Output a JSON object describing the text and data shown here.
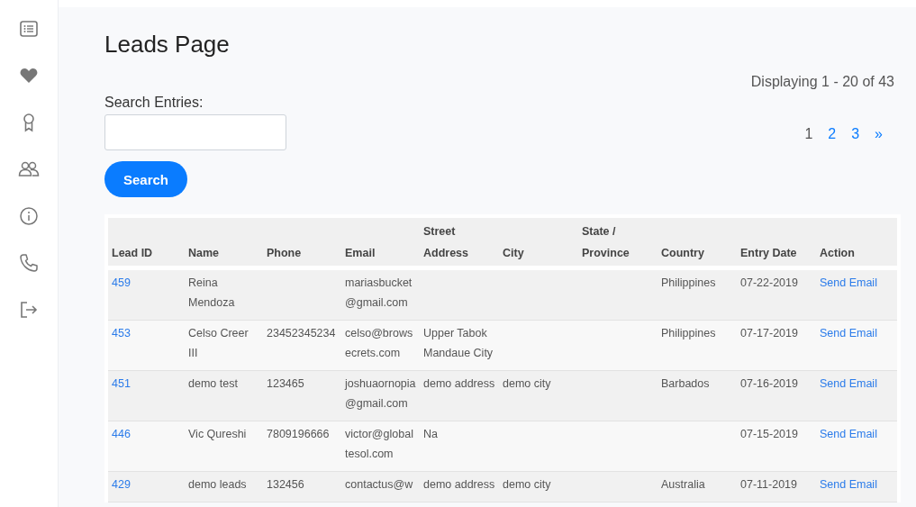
{
  "page": {
    "title": "Leads Page",
    "search": {
      "label": "Search Entries:",
      "button": "Search"
    },
    "displaying": "Displaying 1 - 20 of 43",
    "pagination": [
      {
        "label": "1",
        "selected": true
      },
      {
        "label": "2",
        "selected": false
      },
      {
        "label": "3",
        "selected": false
      },
      {
        "label": "»",
        "selected": false
      }
    ]
  },
  "table": {
    "columns": [
      "Lead ID",
      "Name",
      "Phone",
      "Email",
      "Street Address",
      "City",
      "State / Province",
      "Country",
      "Entry Date",
      "Action"
    ],
    "rows": [
      [
        "459",
        "Reina Mendoza",
        "",
        "mariasbucket@gmail.com",
        "",
        "",
        "",
        "Philippines",
        "07-22-2019",
        "Send Email"
      ],
      [
        "453",
        "Celso Creer III",
        "23452345234",
        "celso@browsecrets.com",
        "Upper Tabok Mandaue City",
        "",
        "",
        "Philippines",
        "07-17-2019",
        "Send Email"
      ],
      [
        "451",
        "demo test",
        "123465",
        "joshuaornopia@gmail.com",
        "demo address",
        "demo city",
        "",
        "Barbados",
        "07-16-2019",
        "Send Email"
      ],
      [
        "446",
        "Vic Qureshi",
        "7809196666",
        "victor@globaltesol.com",
        "Na",
        "",
        "",
        "",
        "07-15-2019",
        "Send Email"
      ],
      [
        "429",
        "demo leads",
        "132456",
        "contactus@w",
        "demo address",
        "demo city",
        "",
        "Australia",
        "07-11-2019",
        "Send Email"
      ]
    ]
  }
}
